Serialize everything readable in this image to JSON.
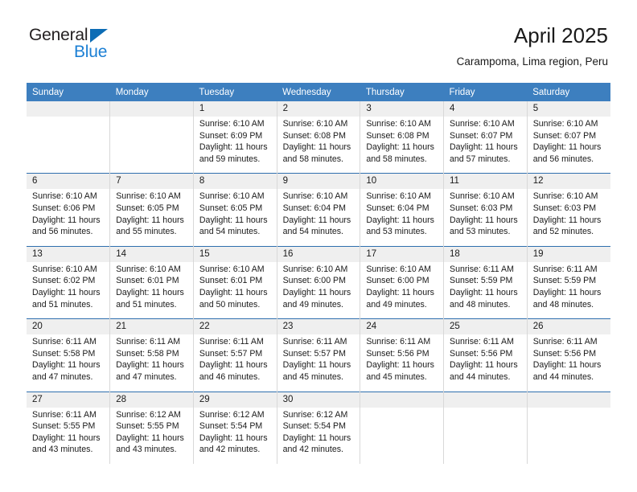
{
  "brand": {
    "name_part1": "General",
    "name_part2": "Blue",
    "triangle_icon": "triangle-icon",
    "color_dark": "#231f20",
    "color_blue": "#1b7fd4"
  },
  "header": {
    "title": "April 2025",
    "subtitle": "Carampoma, Lima region, Peru"
  },
  "theme": {
    "header_blue": "#3d7fbf",
    "week_divider_blue": "#2f6fae",
    "daynum_band": "#efefef",
    "cell_border": "#d8d8d8"
  },
  "weekday_headers": [
    "Sunday",
    "Monday",
    "Tuesday",
    "Wednesday",
    "Thursday",
    "Friday",
    "Saturday"
  ],
  "weeks": [
    {
      "days": [
        {
          "date": "",
          "sunrise": "",
          "sunset": "",
          "daylight_1": "",
          "daylight_2": "",
          "empty": true
        },
        {
          "date": "",
          "sunrise": "",
          "sunset": "",
          "daylight_1": "",
          "daylight_2": "",
          "empty": true
        },
        {
          "date": "1",
          "sunrise": "Sunrise: 6:10 AM",
          "sunset": "Sunset: 6:09 PM",
          "daylight_1": "Daylight: 11 hours",
          "daylight_2": "and 59 minutes.",
          "empty": false
        },
        {
          "date": "2",
          "sunrise": "Sunrise: 6:10 AM",
          "sunset": "Sunset: 6:08 PM",
          "daylight_1": "Daylight: 11 hours",
          "daylight_2": "and 58 minutes.",
          "empty": false
        },
        {
          "date": "3",
          "sunrise": "Sunrise: 6:10 AM",
          "sunset": "Sunset: 6:08 PM",
          "daylight_1": "Daylight: 11 hours",
          "daylight_2": "and 58 minutes.",
          "empty": false
        },
        {
          "date": "4",
          "sunrise": "Sunrise: 6:10 AM",
          "sunset": "Sunset: 6:07 PM",
          "daylight_1": "Daylight: 11 hours",
          "daylight_2": "and 57 minutes.",
          "empty": false
        },
        {
          "date": "5",
          "sunrise": "Sunrise: 6:10 AM",
          "sunset": "Sunset: 6:07 PM",
          "daylight_1": "Daylight: 11 hours",
          "daylight_2": "and 56 minutes.",
          "empty": false
        }
      ]
    },
    {
      "days": [
        {
          "date": "6",
          "sunrise": "Sunrise: 6:10 AM",
          "sunset": "Sunset: 6:06 PM",
          "daylight_1": "Daylight: 11 hours",
          "daylight_2": "and 56 minutes.",
          "empty": false
        },
        {
          "date": "7",
          "sunrise": "Sunrise: 6:10 AM",
          "sunset": "Sunset: 6:05 PM",
          "daylight_1": "Daylight: 11 hours",
          "daylight_2": "and 55 minutes.",
          "empty": false
        },
        {
          "date": "8",
          "sunrise": "Sunrise: 6:10 AM",
          "sunset": "Sunset: 6:05 PM",
          "daylight_1": "Daylight: 11 hours",
          "daylight_2": "and 54 minutes.",
          "empty": false
        },
        {
          "date": "9",
          "sunrise": "Sunrise: 6:10 AM",
          "sunset": "Sunset: 6:04 PM",
          "daylight_1": "Daylight: 11 hours",
          "daylight_2": "and 54 minutes.",
          "empty": false
        },
        {
          "date": "10",
          "sunrise": "Sunrise: 6:10 AM",
          "sunset": "Sunset: 6:04 PM",
          "daylight_1": "Daylight: 11 hours",
          "daylight_2": "and 53 minutes.",
          "empty": false
        },
        {
          "date": "11",
          "sunrise": "Sunrise: 6:10 AM",
          "sunset": "Sunset: 6:03 PM",
          "daylight_1": "Daylight: 11 hours",
          "daylight_2": "and 53 minutes.",
          "empty": false
        },
        {
          "date": "12",
          "sunrise": "Sunrise: 6:10 AM",
          "sunset": "Sunset: 6:03 PM",
          "daylight_1": "Daylight: 11 hours",
          "daylight_2": "and 52 minutes.",
          "empty": false
        }
      ]
    },
    {
      "days": [
        {
          "date": "13",
          "sunrise": "Sunrise: 6:10 AM",
          "sunset": "Sunset: 6:02 PM",
          "daylight_1": "Daylight: 11 hours",
          "daylight_2": "and 51 minutes.",
          "empty": false
        },
        {
          "date": "14",
          "sunrise": "Sunrise: 6:10 AM",
          "sunset": "Sunset: 6:01 PM",
          "daylight_1": "Daylight: 11 hours",
          "daylight_2": "and 51 minutes.",
          "empty": false
        },
        {
          "date": "15",
          "sunrise": "Sunrise: 6:10 AM",
          "sunset": "Sunset: 6:01 PM",
          "daylight_1": "Daylight: 11 hours",
          "daylight_2": "and 50 minutes.",
          "empty": false
        },
        {
          "date": "16",
          "sunrise": "Sunrise: 6:10 AM",
          "sunset": "Sunset: 6:00 PM",
          "daylight_1": "Daylight: 11 hours",
          "daylight_2": "and 49 minutes.",
          "empty": false
        },
        {
          "date": "17",
          "sunrise": "Sunrise: 6:10 AM",
          "sunset": "Sunset: 6:00 PM",
          "daylight_1": "Daylight: 11 hours",
          "daylight_2": "and 49 minutes.",
          "empty": false
        },
        {
          "date": "18",
          "sunrise": "Sunrise: 6:11 AM",
          "sunset": "Sunset: 5:59 PM",
          "daylight_1": "Daylight: 11 hours",
          "daylight_2": "and 48 minutes.",
          "empty": false
        },
        {
          "date": "19",
          "sunrise": "Sunrise: 6:11 AM",
          "sunset": "Sunset: 5:59 PM",
          "daylight_1": "Daylight: 11 hours",
          "daylight_2": "and 48 minutes.",
          "empty": false
        }
      ]
    },
    {
      "days": [
        {
          "date": "20",
          "sunrise": "Sunrise: 6:11 AM",
          "sunset": "Sunset: 5:58 PM",
          "daylight_1": "Daylight: 11 hours",
          "daylight_2": "and 47 minutes.",
          "empty": false
        },
        {
          "date": "21",
          "sunrise": "Sunrise: 6:11 AM",
          "sunset": "Sunset: 5:58 PM",
          "daylight_1": "Daylight: 11 hours",
          "daylight_2": "and 47 minutes.",
          "empty": false
        },
        {
          "date": "22",
          "sunrise": "Sunrise: 6:11 AM",
          "sunset": "Sunset: 5:57 PM",
          "daylight_1": "Daylight: 11 hours",
          "daylight_2": "and 46 minutes.",
          "empty": false
        },
        {
          "date": "23",
          "sunrise": "Sunrise: 6:11 AM",
          "sunset": "Sunset: 5:57 PM",
          "daylight_1": "Daylight: 11 hours",
          "daylight_2": "and 45 minutes.",
          "empty": false
        },
        {
          "date": "24",
          "sunrise": "Sunrise: 6:11 AM",
          "sunset": "Sunset: 5:56 PM",
          "daylight_1": "Daylight: 11 hours",
          "daylight_2": "and 45 minutes.",
          "empty": false
        },
        {
          "date": "25",
          "sunrise": "Sunrise: 6:11 AM",
          "sunset": "Sunset: 5:56 PM",
          "daylight_1": "Daylight: 11 hours",
          "daylight_2": "and 44 minutes.",
          "empty": false
        },
        {
          "date": "26",
          "sunrise": "Sunrise: 6:11 AM",
          "sunset": "Sunset: 5:56 PM",
          "daylight_1": "Daylight: 11 hours",
          "daylight_2": "and 44 minutes.",
          "empty": false
        }
      ]
    },
    {
      "days": [
        {
          "date": "27",
          "sunrise": "Sunrise: 6:11 AM",
          "sunset": "Sunset: 5:55 PM",
          "daylight_1": "Daylight: 11 hours",
          "daylight_2": "and 43 minutes.",
          "empty": false
        },
        {
          "date": "28",
          "sunrise": "Sunrise: 6:12 AM",
          "sunset": "Sunset: 5:55 PM",
          "daylight_1": "Daylight: 11 hours",
          "daylight_2": "and 43 minutes.",
          "empty": false
        },
        {
          "date": "29",
          "sunrise": "Sunrise: 6:12 AM",
          "sunset": "Sunset: 5:54 PM",
          "daylight_1": "Daylight: 11 hours",
          "daylight_2": "and 42 minutes.",
          "empty": false
        },
        {
          "date": "30",
          "sunrise": "Sunrise: 6:12 AM",
          "sunset": "Sunset: 5:54 PM",
          "daylight_1": "Daylight: 11 hours",
          "daylight_2": "and 42 minutes.",
          "empty": false
        },
        {
          "date": "",
          "sunrise": "",
          "sunset": "",
          "daylight_1": "",
          "daylight_2": "",
          "empty": true
        },
        {
          "date": "",
          "sunrise": "",
          "sunset": "",
          "daylight_1": "",
          "daylight_2": "",
          "empty": true
        },
        {
          "date": "",
          "sunrise": "",
          "sunset": "",
          "daylight_1": "",
          "daylight_2": "",
          "empty": true
        }
      ]
    }
  ]
}
